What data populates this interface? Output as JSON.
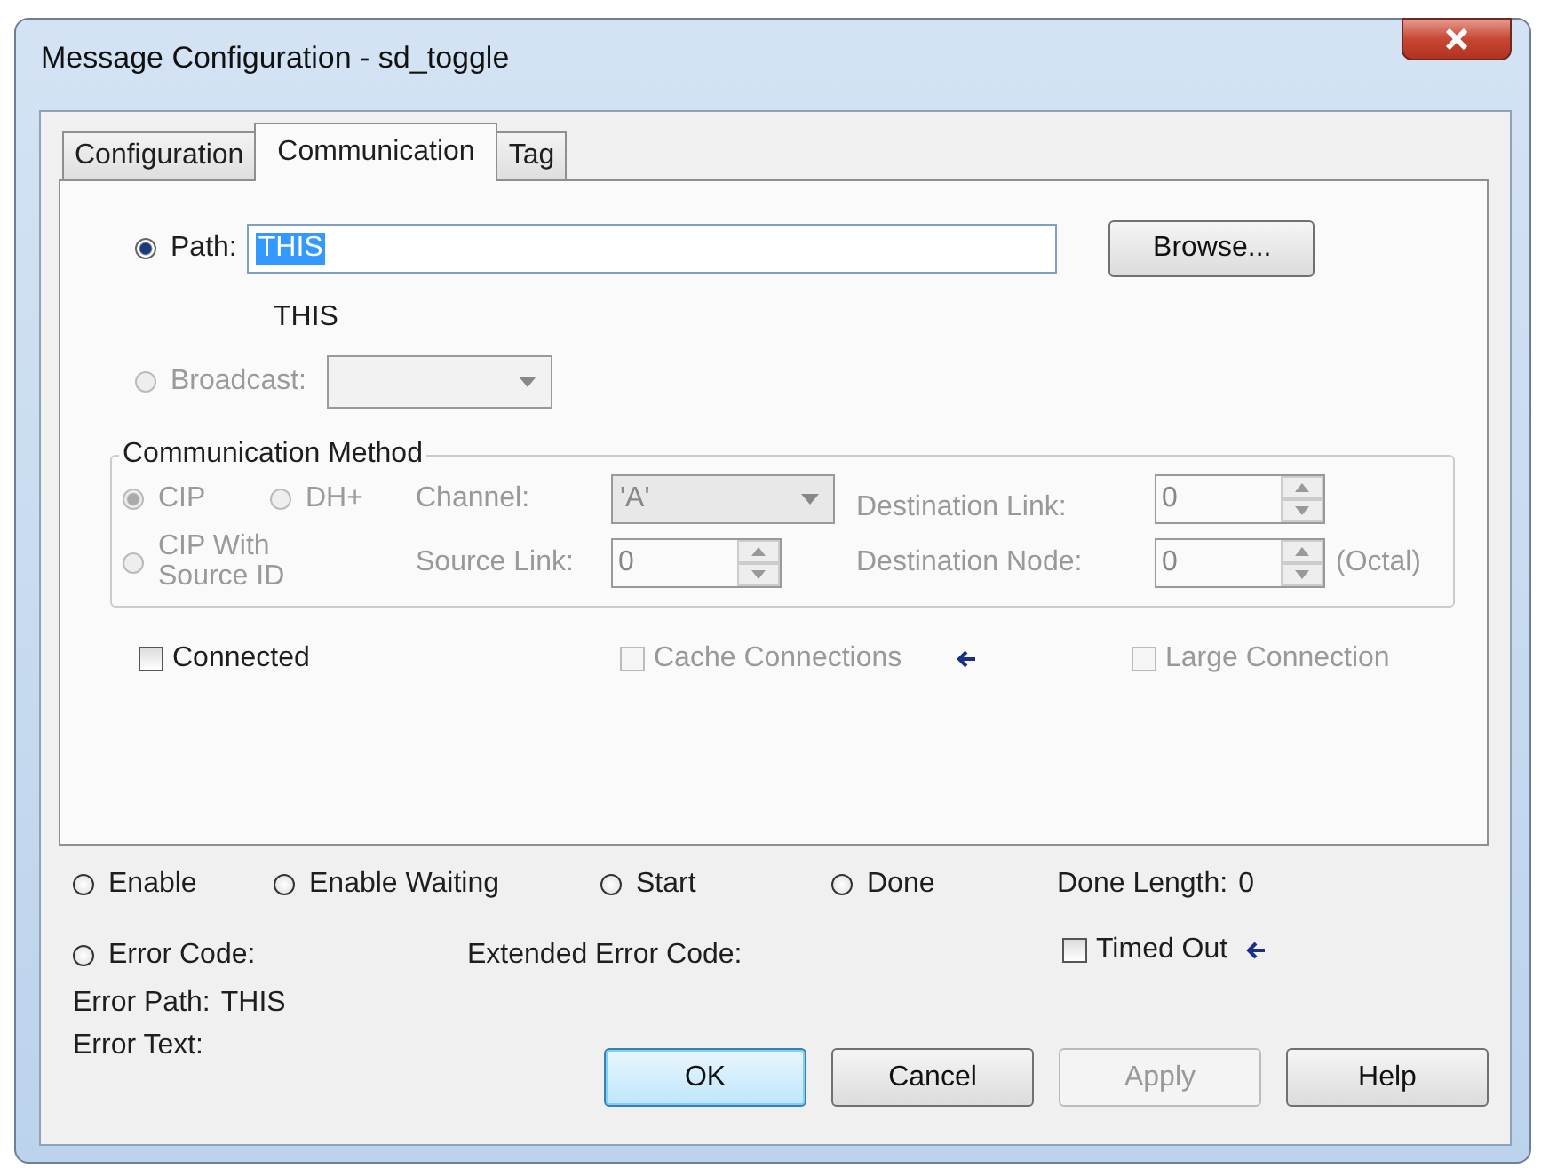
{
  "window": {
    "title": "Message Configuration - sd_toggle"
  },
  "tabs": [
    {
      "label": "Configuration",
      "selected": false
    },
    {
      "label": "Communication",
      "selected": true
    },
    {
      "label": "Tag",
      "selected": false
    }
  ],
  "path": {
    "label": "Path:",
    "selected": true,
    "value": "THIS",
    "highlighted": true
  },
  "browse_button": "Browse...",
  "resolved_path": "THIS",
  "broadcast": {
    "label": "Broadcast:",
    "selected": false,
    "disabled": true
  },
  "communication_method": {
    "title": "Communication Method",
    "disabled": true,
    "methods": [
      {
        "label": "CIP",
        "selected": true
      },
      {
        "label": "DH+",
        "selected": false
      },
      {
        "label": "CIP With Source ID",
        "selected": false
      }
    ],
    "channel": {
      "label": "Channel:",
      "value": "'A'"
    },
    "source_link": {
      "label": "Source Link:",
      "value": "0"
    },
    "destination_link": {
      "label": "Destination Link:",
      "value": "0"
    },
    "destination_node": {
      "label": "Destination Node:",
      "value": "0",
      "unit": "(Octal)"
    }
  },
  "connection_options": [
    {
      "label": "Connected",
      "checked": false,
      "disabled": false,
      "arrow": false
    },
    {
      "label": "Cache Connections",
      "checked": false,
      "disabled": true,
      "arrow": true
    },
    {
      "label": "Large Connection",
      "checked": false,
      "disabled": true,
      "arrow": false
    }
  ],
  "status": [
    {
      "label": "Enable",
      "on": false
    },
    {
      "label": "Enable Waiting",
      "on": false
    },
    {
      "label": "Start",
      "on": false
    },
    {
      "label": "Done",
      "on": false
    }
  ],
  "done_length": {
    "label": "Done Length:",
    "value": "0"
  },
  "error_code": {
    "label": "Error Code:",
    "on": false
  },
  "extended_error_code": "Extended Error Code:",
  "timed_out": {
    "label": "Timed Out",
    "checked": false,
    "arrow": true
  },
  "error_path": {
    "label": "Error Path:",
    "value": "THIS"
  },
  "error_text": "Error Text:",
  "buttons": [
    {
      "label": "OK",
      "default": true,
      "disabled": false
    },
    {
      "label": "Cancel",
      "default": false,
      "disabled": false
    },
    {
      "label": "Apply",
      "default": false,
      "disabled": true
    },
    {
      "label": "Help",
      "default": false,
      "disabled": false
    }
  ]
}
